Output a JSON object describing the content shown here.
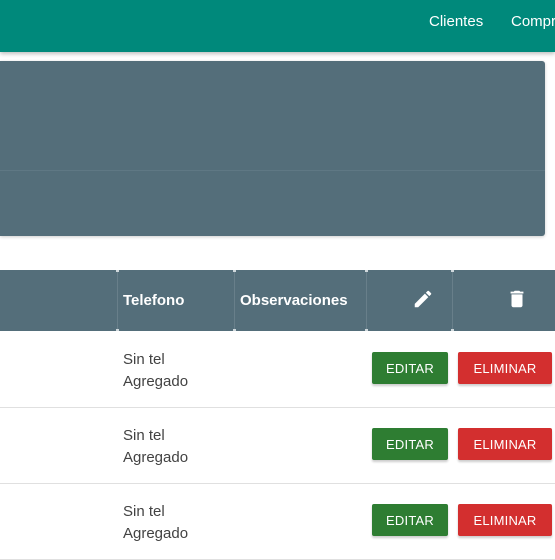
{
  "nav": {
    "items": [
      {
        "label": "Clientes"
      },
      {
        "label": "Compr"
      }
    ]
  },
  "table": {
    "headers": {
      "telefono": "Telefono",
      "observaciones": "Observaciones",
      "edit_icon": "pencil-icon",
      "delete_icon": "trash-icon"
    },
    "rows": [
      {
        "telefono_1": "Sin tel",
        "telefono_2": "Agregado",
        "observaciones": "",
        "edit_label": "EDITAR",
        "delete_label": "ELIMINAR"
      },
      {
        "telefono_1": "Sin tel",
        "telefono_2": "Agregado",
        "observaciones": "",
        "edit_label": "EDITAR",
        "delete_label": "ELIMINAR"
      },
      {
        "telefono_1": "Sin tel",
        "telefono_2": "Agregado",
        "observaciones": "",
        "edit_label": "EDITAR",
        "delete_label": "ELIMINAR"
      }
    ]
  },
  "colors": {
    "topbar": "#00897b",
    "panel": "#546e7a",
    "edit_button": "#2e7d32",
    "delete_button": "#d32f2f"
  }
}
